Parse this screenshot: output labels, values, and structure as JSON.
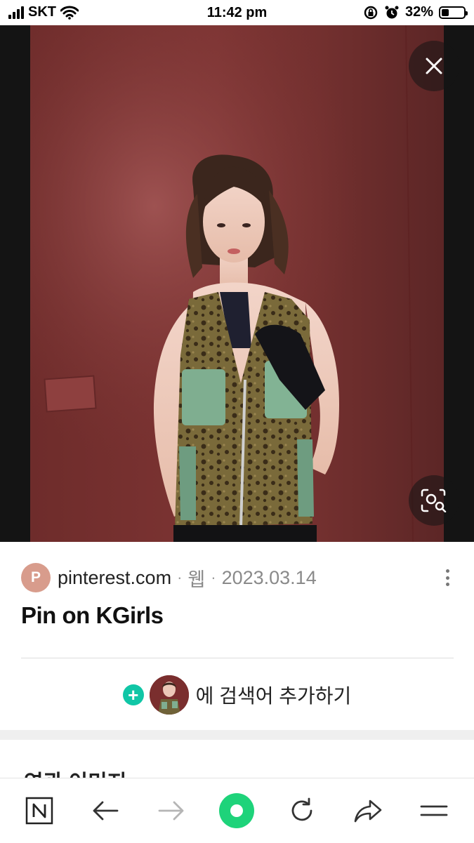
{
  "status_bar": {
    "carrier": "SKT",
    "time": "11:42 pm",
    "battery_percent": "32%",
    "battery_level": 0.32,
    "icons": [
      "signal-icon",
      "wifi-icon",
      "orientation-lock-icon",
      "alarm-icon",
      "battery-icon"
    ]
  },
  "viewer": {
    "close_icon": "close-icon",
    "lens_icon": "image-search-icon"
  },
  "result": {
    "source_initial": "P",
    "domain": "pinterest.com",
    "type": "웹",
    "date": "2023.03.14",
    "title": "Pin on KGirls"
  },
  "add_search": {
    "plus": "+",
    "label": "에 검색어 추가하기"
  },
  "related": {
    "heading": "연관 이미지"
  },
  "toolbar": {
    "items": [
      "naver-home-icon",
      "back-arrow-icon",
      "forward-arrow-icon",
      "green-dot-icon",
      "refresh-icon",
      "share-icon",
      "menu-icon"
    ]
  },
  "colors": {
    "accent_green": "#1ed37a",
    "plus_teal": "#10c6a6",
    "source_avatar": "#d89c8c",
    "wall": "#7d3433"
  }
}
